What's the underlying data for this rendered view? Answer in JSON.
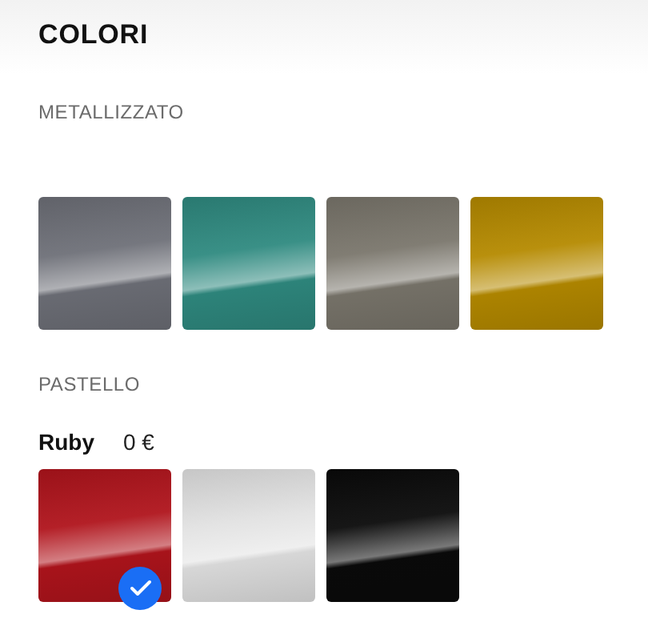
{
  "title": "COLORI",
  "groups": [
    {
      "label": "METALLIZZATO",
      "swatches": [
        {
          "color": "#6e7078",
          "selected": false
        },
        {
          "color": "#2f8a80",
          "selected": false
        },
        {
          "color": "#7a766c",
          "selected": false
        },
        {
          "color": "#b58a00",
          "selected": false
        }
      ]
    },
    {
      "label": "PASTELLO",
      "selected_name": "Ruby",
      "selected_price": "0 €",
      "swatches": [
        {
          "color": "#b0141c",
          "selected": true
        },
        {
          "color": "#e2e2e2",
          "selected": false
        },
        {
          "color": "#0a0a0a",
          "selected": false
        }
      ]
    }
  ]
}
